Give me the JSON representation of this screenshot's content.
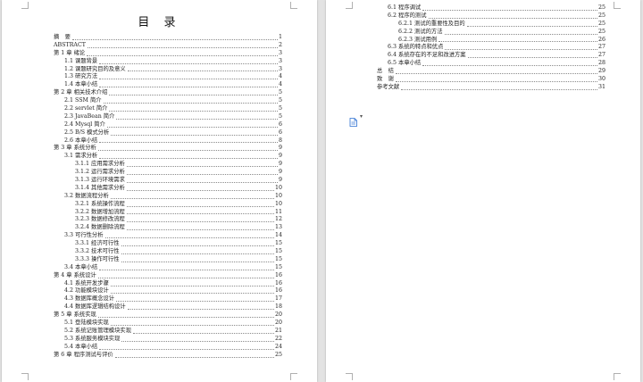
{
  "left_page": {
    "title": "目 录",
    "entries": [
      {
        "level": 1,
        "text": "摘　要",
        "page": "1"
      },
      {
        "level": 1,
        "text": "ABSTRACT",
        "page": "2"
      },
      {
        "level": 1,
        "text": "第 1 章  绪论",
        "page": "3"
      },
      {
        "level": 2,
        "text": "1.1  课题背景",
        "page": "3"
      },
      {
        "level": 2,
        "text": "1.2  课题研究目的及意义",
        "page": "3"
      },
      {
        "level": 2,
        "text": "1.3  研究方法",
        "page": "4"
      },
      {
        "level": 2,
        "text": "1.4  本章小结",
        "page": "4"
      },
      {
        "level": 1,
        "text": "第 2 章  相关技术介绍",
        "page": "5"
      },
      {
        "level": 2,
        "text": "2.1 SSM 简介",
        "page": "5"
      },
      {
        "level": 2,
        "text": "2.2 servlet 简介",
        "page": "5"
      },
      {
        "level": 2,
        "text": "2.3 JavaBean 简介",
        "page": "5"
      },
      {
        "level": 2,
        "text": "2.4 Mysql 简介",
        "page": "6"
      },
      {
        "level": 2,
        "text": "2.5 B/S 模式分析",
        "page": "6"
      },
      {
        "level": 2,
        "text": "2.6  本章小结",
        "page": "8"
      },
      {
        "level": 1,
        "text": "第 3 章  系统分析",
        "page": "9"
      },
      {
        "level": 2,
        "text": "3.1  需求分析",
        "page": "9"
      },
      {
        "level": 3,
        "text": "3.1.1  应用需求分析",
        "page": "9"
      },
      {
        "level": 3,
        "text": "3.1.2  运行需求分析",
        "page": "9"
      },
      {
        "level": 3,
        "text": "3.1.3  运行环境需求",
        "page": "9"
      },
      {
        "level": 3,
        "text": "3.1.4  其他需求分析",
        "page": "10"
      },
      {
        "level": 2,
        "text": "3.2  数据流程分析",
        "page": "10"
      },
      {
        "level": 3,
        "text": "3.2.1  系统操作流程",
        "page": "10"
      },
      {
        "level": 3,
        "text": "3.2.2  数据增加流程",
        "page": "11"
      },
      {
        "level": 3,
        "text": "3.2.3  数据修改流程",
        "page": "12"
      },
      {
        "level": 3,
        "text": "3.2.4  数据删除流程",
        "page": "13"
      },
      {
        "level": 2,
        "text": "3.3  可行性分析",
        "page": "14"
      },
      {
        "level": 3,
        "text": "3.3.1  经济可行性",
        "page": "15"
      },
      {
        "level": 3,
        "text": "3.3.2  技术可行性",
        "page": "15"
      },
      {
        "level": 3,
        "text": "3.3.3  操作可行性",
        "page": "15"
      },
      {
        "level": 2,
        "text": "3.4  本章小结",
        "page": "15"
      },
      {
        "level": 1,
        "text": "第 4 章  系统设计",
        "page": "16"
      },
      {
        "level": 2,
        "text": "4.1  系统开发步骤",
        "page": "16"
      },
      {
        "level": 2,
        "text": "4.2  功能模块设计",
        "page": "16"
      },
      {
        "level": 2,
        "text": "4.3  数据库概念设计",
        "page": "17"
      },
      {
        "level": 2,
        "text": "4.4  数据库逻辑结构设计",
        "page": "18"
      },
      {
        "level": 1,
        "text": "第 5 章  系统实现",
        "page": "20"
      },
      {
        "level": 2,
        "text": "5.1  登陆模块实现",
        "page": "20"
      },
      {
        "level": 2,
        "text": "5.2  系统记账管理模块实现",
        "page": "21"
      },
      {
        "level": 2,
        "text": "5.3  系统服务模块实现",
        "page": "22"
      },
      {
        "level": 2,
        "text": "5.4  本章小结",
        "page": "24"
      },
      {
        "level": 1,
        "text": "第 6 章  程序测试与评价",
        "page": "25"
      }
    ]
  },
  "right_page": {
    "entries": [
      {
        "level": 2,
        "text": "6.1  程序调试",
        "page": "25"
      },
      {
        "level": 2,
        "text": "6.2  程序的测试",
        "page": "25"
      },
      {
        "level": 3,
        "text": "6.2.1  测试的重要性及目的",
        "page": "25"
      },
      {
        "level": 3,
        "text": "6.2.2  测试的方法",
        "page": "25"
      },
      {
        "level": 3,
        "text": "6.2.3  测试用例",
        "page": "26"
      },
      {
        "level": 2,
        "text": "6.3  系统的特点和优点",
        "page": "27"
      },
      {
        "level": 2,
        "text": "6.4  系统存在的不足和改进方案",
        "page": "27"
      },
      {
        "level": 2,
        "text": "6.5  本章小结",
        "page": "28"
      },
      {
        "level": 1,
        "text": "总　结",
        "page": "29"
      },
      {
        "level": 1,
        "text": "致　谢",
        "page": "30"
      },
      {
        "level": 1,
        "text": "参考文献",
        "page": "31"
      }
    ]
  },
  "toolbar": {
    "icon": "document-icon",
    "caret": "▾"
  },
  "colors": {
    "canvas": "#e3e3e3",
    "page": "#ffffff",
    "icon_blue": "#2b6fd1"
  }
}
